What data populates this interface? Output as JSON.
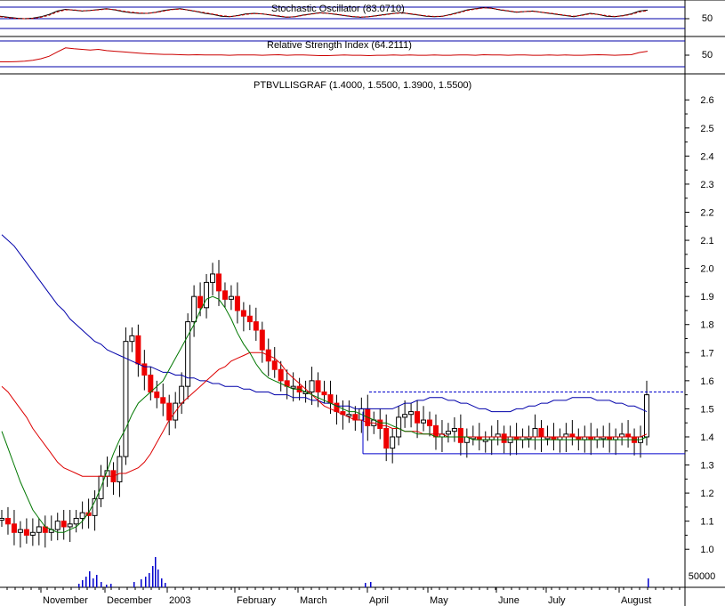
{
  "chart_data": [
    {
      "type": "line",
      "panel": "stochastic",
      "title": "Stochastic Oscillator (83.0710)",
      "ytick_labels": [
        "50"
      ],
      "ylim": [
        0,
        100
      ],
      "series": [
        {
          "color": "#000000",
          "values": [
            62,
            58,
            55,
            53,
            55,
            60,
            68,
            80,
            86,
            83,
            80,
            82,
            85,
            88,
            84,
            78,
            74,
            72,
            72,
            76,
            82,
            86,
            88,
            83,
            78,
            72,
            68,
            62,
            60,
            64,
            70,
            72,
            70,
            66,
            62,
            58,
            60,
            66,
            70,
            74,
            72,
            68,
            64,
            60,
            58,
            60,
            64,
            68,
            72,
            74,
            70,
            66,
            62,
            60,
            62,
            68,
            76,
            84,
            88,
            92,
            90,
            84,
            80,
            76,
            78,
            80,
            76,
            72,
            68,
            64,
            60,
            66,
            72,
            68,
            62,
            60,
            64,
            70,
            80,
            83
          ]
        },
        {
          "color": "#cc0000",
          "values": [
            60,
            57,
            54,
            53,
            54,
            58,
            65,
            77,
            84,
            84,
            81,
            82,
            84,
            87,
            85,
            80,
            76,
            73,
            72,
            75,
            80,
            85,
            87,
            84,
            79,
            74,
            69,
            64,
            61,
            63,
            68,
            71,
            70,
            67,
            63,
            59,
            60,
            65,
            69,
            73,
            72,
            69,
            65,
            61,
            59,
            60,
            63,
            67,
            71,
            73,
            71,
            67,
            63,
            61,
            62,
            67,
            74,
            82,
            87,
            91,
            90,
            85,
            81,
            77,
            78,
            79,
            76,
            73,
            69,
            65,
            62,
            65,
            70,
            68,
            64,
            61,
            63,
            68,
            77,
            81
          ]
        }
      ]
    },
    {
      "type": "line",
      "panel": "rsi",
      "title": "Relative Strength Index (64.2111)",
      "ytick_labels": [
        "50"
      ],
      "ylim": [
        0,
        100
      ],
      "series": [
        {
          "color": "#cc0000",
          "values": [
            30,
            30,
            31,
            32,
            35,
            40,
            48,
            62,
            75,
            72,
            70,
            68,
            70,
            66,
            64,
            62,
            60,
            58,
            56,
            55,
            54,
            54,
            53,
            52,
            53,
            52,
            52,
            52,
            51,
            52,
            52,
            52,
            51,
            52,
            53,
            51,
            52,
            52,
            51,
            50,
            50,
            51,
            52,
            51,
            51,
            50,
            51,
            51,
            52,
            51,
            52,
            51,
            51,
            52,
            51,
            51,
            52,
            52,
            51,
            53,
            52,
            52,
            51,
            52,
            52,
            51,
            51,
            52,
            51,
            52,
            51,
            51,
            52,
            53,
            52,
            51,
            52,
            53,
            60,
            64
          ]
        }
      ]
    },
    {
      "type": "candlestick",
      "panel": "price",
      "title": "PTBVLLISGRAF (1.4000, 1.5500, 1.3900, 1.5500)",
      "ylim": [
        0.95,
        2.68
      ],
      "yticks": [
        1.0,
        1.1,
        1.2,
        1.3,
        1.4,
        1.5,
        1.6,
        1.7,
        1.8,
        1.9,
        2.0,
        2.1,
        2.2,
        2.3,
        2.4,
        2.5,
        2.6
      ],
      "ytick_labels": [
        "1.0",
        "1.1",
        "1.2",
        "1.3",
        "1.4",
        "1.5",
        "1.6",
        "1.7",
        "1.8",
        "1.9",
        "2.0",
        "2.1",
        "2.2",
        "2.3",
        "2.4",
        "2.5",
        "2.6"
      ],
      "volume_label": "50000",
      "xtick_labels": [
        "November",
        "December",
        "2003",
        "February",
        "March",
        "April",
        "May",
        "June",
        "July",
        "August"
      ],
      "close": [
        1.11,
        1.09,
        1.06,
        1.07,
        1.05,
        1.06,
        1.08,
        1.06,
        1.07,
        1.1,
        1.08,
        1.09,
        1.11,
        1.13,
        1.12,
        1.18,
        1.26,
        1.28,
        1.24,
        1.33,
        1.74,
        1.76,
        1.66,
        1.62,
        1.56,
        1.54,
        1.52,
        1.46,
        1.52,
        1.58,
        1.81,
        1.9,
        1.86,
        1.95,
        1.98,
        1.92,
        1.89,
        1.9,
        1.85,
        1.83,
        1.81,
        1.78,
        1.71,
        1.67,
        1.64,
        1.6,
        1.58,
        1.58,
        1.56,
        1.56,
        1.6,
        1.56,
        1.55,
        1.52,
        1.49,
        1.48,
        1.48,
        1.46,
        1.5,
        1.44,
        1.46,
        1.43,
        1.36,
        1.4,
        1.47,
        1.48,
        1.49,
        1.45,
        1.46,
        1.44,
        1.4,
        1.41,
        1.42,
        1.43,
        1.38,
        1.4,
        1.4,
        1.39,
        1.39,
        1.4,
        1.41,
        1.38,
        1.4,
        1.39,
        1.4,
        1.4,
        1.43,
        1.4,
        1.4,
        1.39,
        1.4,
        1.41,
        1.4,
        1.39,
        1.4,
        1.39,
        1.4,
        1.4,
        1.39,
        1.4,
        1.41,
        1.4,
        1.38,
        1.4,
        1.55
      ],
      "moving_averages": [
        {
          "color": "#0000aa",
          "values": [
            2.12,
            2.1,
            2.08,
            2.05,
            2.02,
            1.99,
            1.96,
            1.93,
            1.9,
            1.87,
            1.85,
            1.82,
            1.8,
            1.78,
            1.76,
            1.74,
            1.73,
            1.71,
            1.7,
            1.69,
            1.68,
            1.67,
            1.66,
            1.65,
            1.65,
            1.64,
            1.63,
            1.63,
            1.62,
            1.62,
            1.61,
            1.61,
            1.6,
            1.6,
            1.59,
            1.59,
            1.58,
            1.58,
            1.58,
            1.57,
            1.57,
            1.56,
            1.56,
            1.56,
            1.55,
            1.55,
            1.55,
            1.54,
            1.54,
            1.54,
            1.53,
            1.53,
            1.52,
            1.52,
            1.51,
            1.51,
            1.51,
            1.5,
            1.5,
            1.5,
            1.5,
            1.5,
            1.5,
            1.5,
            1.51,
            1.52,
            1.52,
            1.53,
            1.53,
            1.54,
            1.54,
            1.54,
            1.53,
            1.53,
            1.52,
            1.52,
            1.51,
            1.5,
            1.5,
            1.49,
            1.49,
            1.49,
            1.49,
            1.5,
            1.5,
            1.51,
            1.51,
            1.52,
            1.52,
            1.53,
            1.53,
            1.53,
            1.54,
            1.54,
            1.54,
            1.54,
            1.53,
            1.53,
            1.53,
            1.52,
            1.52,
            1.51,
            1.51,
            1.5,
            1.49
          ]
        },
        {
          "color": "#dd0000",
          "values": [
            1.58,
            1.56,
            1.53,
            1.5,
            1.47,
            1.43,
            1.4,
            1.37,
            1.34,
            1.31,
            1.29,
            1.28,
            1.27,
            1.26,
            1.26,
            1.26,
            1.26,
            1.26,
            1.26,
            1.27,
            1.27,
            1.28,
            1.29,
            1.31,
            1.34,
            1.38,
            1.42,
            1.46,
            1.49,
            1.52,
            1.54,
            1.56,
            1.58,
            1.6,
            1.62,
            1.64,
            1.65,
            1.67,
            1.68,
            1.69,
            1.7,
            1.7,
            1.7,
            1.69,
            1.68,
            1.66,
            1.63,
            1.61,
            1.59,
            1.57,
            1.55,
            1.53,
            1.51,
            1.5,
            1.49,
            1.48,
            1.47,
            1.46,
            1.46,
            1.45,
            1.45,
            1.44,
            1.44,
            1.43,
            1.43,
            1.42,
            1.42,
            1.42,
            1.41,
            1.41,
            1.41,
            1.41,
            1.4,
            1.4,
            1.4,
            1.4,
            1.4,
            1.4,
            1.4,
            1.4,
            1.4,
            1.4,
            1.4,
            1.4,
            1.4,
            1.4,
            1.4,
            1.4,
            1.4,
            1.4,
            1.4,
            1.4,
            1.4,
            1.4,
            1.4,
            1.4,
            1.4,
            1.4,
            1.4,
            1.4,
            1.4,
            1.4,
            1.4,
            1.4,
            1.41
          ]
        },
        {
          "color": "#007700",
          "values": [
            1.42,
            1.36,
            1.3,
            1.24,
            1.19,
            1.14,
            1.11,
            1.08,
            1.07,
            1.06,
            1.06,
            1.07,
            1.08,
            1.1,
            1.13,
            1.17,
            1.22,
            1.28,
            1.34,
            1.39,
            1.43,
            1.48,
            1.52,
            1.54,
            1.56,
            1.58,
            1.6,
            1.64,
            1.68,
            1.72,
            1.76,
            1.8,
            1.85,
            1.89,
            1.9,
            1.89,
            1.86,
            1.82,
            1.77,
            1.73,
            1.7,
            1.66,
            1.63,
            1.61,
            1.6,
            1.59,
            1.58,
            1.57,
            1.57,
            1.56,
            1.55,
            1.54,
            1.53,
            1.52,
            1.51,
            1.5,
            1.49,
            1.49,
            1.48,
            1.47,
            1.46,
            1.45,
            1.45,
            1.44,
            1.43,
            1.42,
            1.42,
            1.41,
            1.41,
            1.41,
            1.4,
            1.4,
            1.4,
            1.4,
            1.4,
            1.4,
            1.39,
            1.39,
            1.39,
            1.39,
            1.39,
            1.39,
            1.39,
            1.39,
            1.39,
            1.39,
            1.39,
            1.39,
            1.39,
            1.39,
            1.39,
            1.39,
            1.39,
            1.39,
            1.39,
            1.39,
            1.39,
            1.39,
            1.39,
            1.39,
            1.39,
            1.39,
            1.39,
            1.39,
            1.4
          ]
        }
      ],
      "support_line": 1.34,
      "resistance_line": 1.56
    }
  ]
}
